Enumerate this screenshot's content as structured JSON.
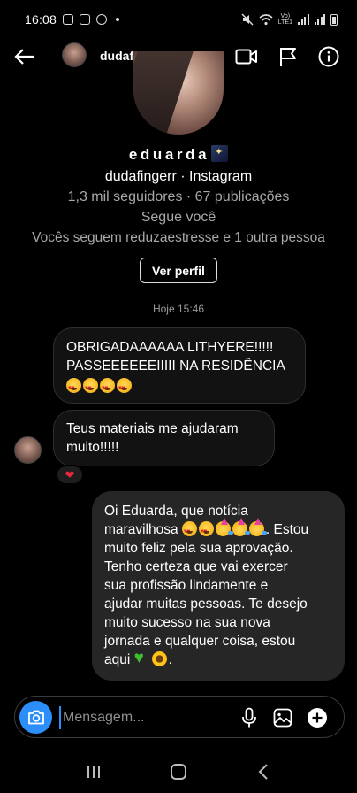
{
  "status_bar": {
    "time": "16:08",
    "left_icons": [
      "instagram-icon",
      "instagram-icon",
      "whatsapp-icon",
      "dot-icon"
    ],
    "right_icons": [
      "mute-icon",
      "wifi-icon",
      "volte-icon",
      "signal-icon",
      "signal-icon",
      "battery-icon"
    ],
    "network_label": "Vo))\nLTE1"
  },
  "header": {
    "username": "dudafingerr",
    "icons": [
      "back-arrow-icon",
      "video-camera-icon",
      "flag-icon",
      "info-icon"
    ]
  },
  "profile": {
    "display_name": "eduarda",
    "name_emoji": "night-sky-emoji",
    "handle_line": "dudafingerr · Instagram",
    "stats_line": "1,3 mil seguidores · 67 publicações",
    "follows_line": "Segue você",
    "mutual_line": "Vocês seguem reduzaestresse e 1 outra pessoa",
    "view_profile_label": "Ver perfil"
  },
  "thread": {
    "timestamp": "Hoje 15:46",
    "messages": [
      {
        "direction": "incoming",
        "text_lines": [
          "OBRIGADAAAAAA LITHYERE!!!!!",
          "PASSEEEEEEIIIII NA RESIDÊNCIA"
        ],
        "emojis": [
          "smiling-face-with-heart-eyes",
          "smiling-face-with-heart-eyes",
          "smiling-face-with-heart-eyes",
          "smiling-face-with-heart-eyes"
        ]
      },
      {
        "direction": "incoming",
        "text_lines": [
          "Teus materiais me ajudaram",
          "muito!!!!!"
        ],
        "reaction": "❤"
      },
      {
        "direction": "outgoing",
        "line1": "Oi Eduarda, que notícia",
        "line2_text": "maravilhosa ",
        "line2_after": ". Estou",
        "line3": "muito feliz pela sua aprovação.",
        "line4": "Tenho certeza que vai exercer",
        "line5": "sua profissão lindamente e",
        "line6": "ajudar muitas pessoas. Te desejo",
        "line7": "muito sucesso na sua nova",
        "line8": "jornada e qualquer coisa, estou",
        "line9_text": "aqui ",
        "line9_after": ".",
        "emojis_line2": [
          "smiling-face-with-heart-eyes",
          "smiling-face-with-heart-eyes",
          "partying-face",
          "partying-face",
          "partying-face"
        ],
        "emojis_line9": [
          "green-heart",
          "sunflower"
        ]
      }
    ]
  },
  "composer": {
    "placeholder": "Mensagem...",
    "icons": [
      "camera-icon",
      "microphone-icon",
      "gallery-icon",
      "plus-icon"
    ]
  },
  "nav_bar": {
    "icons": [
      "recent-apps-icon",
      "home-icon",
      "back-icon"
    ]
  },
  "colors": {
    "background": "#000000",
    "incoming_bubble": "#121212",
    "outgoing_bubble": "#262626",
    "accent_blue": "#2c8ef8",
    "muted_text": "#a8a8a8"
  }
}
